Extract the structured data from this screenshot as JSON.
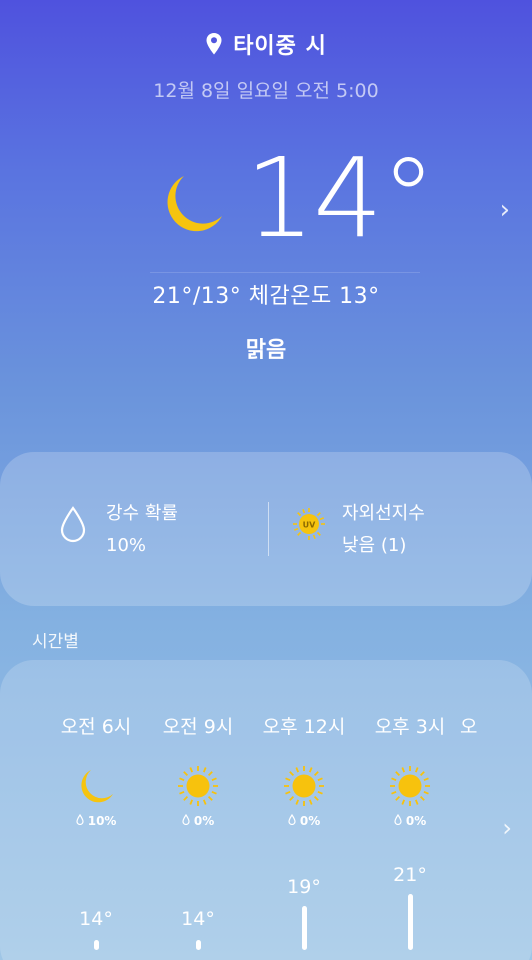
{
  "header": {
    "location": "타이중 시",
    "datetime": "12월 8일 일요일 오전 5:00"
  },
  "current": {
    "temperature": "14°",
    "icon": "moon-icon",
    "range": "21°/13° 체감온도 13°",
    "condition": "맑음"
  },
  "info": {
    "rain_label": "강수 확률",
    "rain_value": "10%",
    "uv_label": "자외선지수",
    "uv_value": "낮음 (1)",
    "uv_badge": "UV"
  },
  "hourly": {
    "title": "시간별",
    "items": [
      {
        "time": "오전 6시",
        "icon": "moon-icon",
        "precip": "10%",
        "temp": "14°",
        "temp_value": 14
      },
      {
        "time": "오전 9시",
        "icon": "sun-icon",
        "precip": "0%",
        "temp": "14°",
        "temp_value": 14
      },
      {
        "time": "오후 12시",
        "icon": "sun-icon",
        "precip": "0%",
        "temp": "19°",
        "temp_value": 19
      },
      {
        "time": "오후 3시",
        "icon": "sun-icon",
        "precip": "0%",
        "temp": "21°",
        "temp_value": 21
      },
      {
        "time": "오",
        "icon": "",
        "precip": "",
        "temp": "",
        "temp_value": null
      }
    ]
  },
  "colors": {
    "moon": "#f6c40f",
    "sun": "#f7c20d",
    "bg_top": "#4f52de",
    "bg_bottom": "#9fc6e6"
  }
}
